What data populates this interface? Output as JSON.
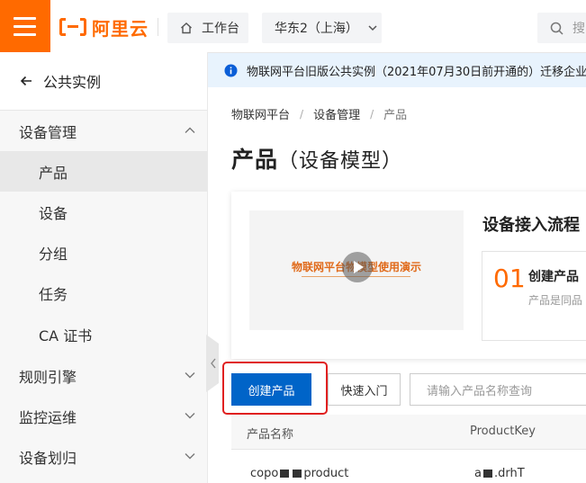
{
  "topbar": {
    "logo_text": "阿里云",
    "workbench_label": "工作台",
    "region_label": "华东2（上海）",
    "search_placeholder": "搜"
  },
  "sidebar": {
    "back_label": "公共实例",
    "items": [
      {
        "label": "设备管理",
        "type": "group",
        "expanded": true
      },
      {
        "label": "产品",
        "type": "sub",
        "active": true
      },
      {
        "label": "设备",
        "type": "sub"
      },
      {
        "label": "分组",
        "type": "sub"
      },
      {
        "label": "任务",
        "type": "sub"
      },
      {
        "label": "CA 证书",
        "type": "sub"
      },
      {
        "label": "规则引擎",
        "type": "group",
        "expanded": false
      },
      {
        "label": "监控运维",
        "type": "group",
        "expanded": false
      },
      {
        "label": "设备划归",
        "type": "group",
        "expanded": false
      }
    ]
  },
  "notice": {
    "text": "物联网平台旧版公共实例（2021年07月30日前开通的）迁移企业"
  },
  "breadcrumb": [
    "物联网平台",
    "设备管理",
    "产品"
  ],
  "page": {
    "title_main": "产品",
    "title_paren": "（设备模型）"
  },
  "intro": {
    "video_title": "物联网平台物模型使用演示",
    "flow_title": "设备接入流程",
    "step_number": "01",
    "step_title": "创建产品",
    "step_desc": "产品是同品"
  },
  "toolbar": {
    "create_label": "创建产品",
    "quick_label": "快速入门",
    "search_placeholder": "请输入产品名称查询"
  },
  "table": {
    "columns": [
      "产品名称",
      "ProductKey"
    ],
    "rows": [
      {
        "name_start": "copo",
        "name_end": "product",
        "key_start": "a",
        "key_end": ".drhT"
      }
    ]
  },
  "colors": {
    "brand": "#ff6a00",
    "primary": "#0064c8",
    "highlight": "#e02020"
  }
}
